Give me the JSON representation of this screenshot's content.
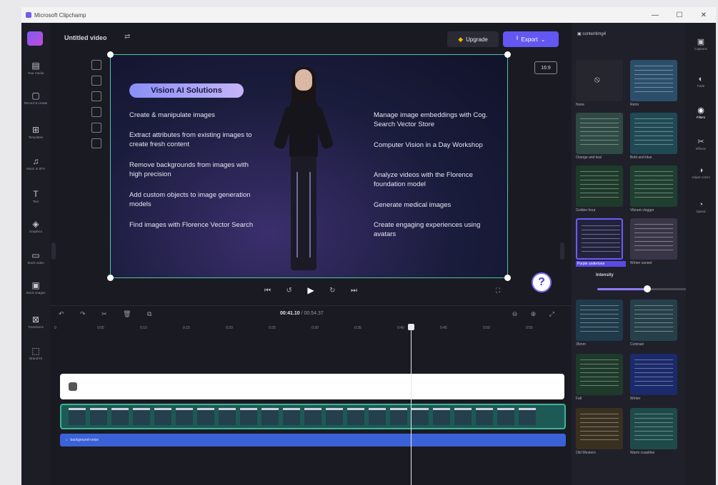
{
  "window": {
    "title": "Microsoft Clipchamp",
    "controls": [
      "—",
      "☐",
      "✕"
    ]
  },
  "left_rail": [
    {
      "name": "your-media",
      "icon": "▤",
      "label": "Your media"
    },
    {
      "name": "record-create",
      "icon": "▢",
      "label": "Record & create"
    },
    {
      "name": "templates",
      "icon": "⊞",
      "label": "Templates"
    },
    {
      "name": "music-sfx",
      "icon": "♫",
      "label": "Music & SFX"
    },
    {
      "name": "text",
      "icon": "T",
      "label": "Text"
    },
    {
      "name": "graphics",
      "icon": "◈",
      "label": "Graphics"
    },
    {
      "name": "stock-video",
      "icon": "▭",
      "label": "Stock video"
    },
    {
      "name": "stock-images",
      "icon": "▣",
      "label": "Stock images"
    },
    {
      "name": "transitions",
      "icon": "⊠",
      "label": "Transitions"
    },
    {
      "name": "brand-kit",
      "icon": "⬚",
      "label": "Brand kit"
    }
  ],
  "header": {
    "project_name": "Untitled video",
    "upgrade_label": "Upgrade",
    "export_label": "Export",
    "export_chevron": "⌄",
    "aspect_ratio": "16:9"
  },
  "slide": {
    "pill_title": "Vision AI Solutions",
    "left_bullets": [
      "Create & manipulate images",
      "Extract attributes from existing images to create fresh content",
      "Remove backgrounds from images with high precision",
      "Add custom objects to image generation models",
      "Find images with Florence Vector Search"
    ],
    "right_bullets": [
      "Manage image embeddings with Cog. Search Vector Store",
      "Computer Vision in a Day Workshop",
      "Analyze videos with the Florence foundation model",
      "Generate medical images",
      "Create engaging experiences using avatars"
    ]
  },
  "playback": {
    "skip_back": "⏮",
    "rewind": "↺",
    "play": "▶",
    "forward": "↻",
    "skip_forward": "⏭",
    "fullscreen": "⛶",
    "help": "?"
  },
  "timeline": {
    "current_time": "00:41.10",
    "total_time": "/ 00:54.37",
    "edit_icons": "↶ ↷ ✂ 🗑 ⧉",
    "zoom_icons": "⊖ ⊕ ⤢",
    "ruler": [
      "0",
      "0:05",
      "0:10",
      "0:15",
      "0:20",
      "0:25",
      "0:30",
      "0:35",
      "0:40",
      "0:45",
      "0:50",
      "0:55"
    ],
    "audio_label": "background-voice",
    "audio_icon": "♪"
  },
  "filters_panel": {
    "header": "contentimg4",
    "intensity_label": "Intensity",
    "intensity": 0.5,
    "filters": [
      {
        "name": "None"
      },
      {
        "name": "Retro"
      },
      {
        "name": "Orange and teal"
      },
      {
        "name": "Bold and blue"
      },
      {
        "name": "Golden hour"
      },
      {
        "name": "Vibrant vlogger"
      },
      {
        "name": "Purple undertone",
        "selected": true
      },
      {
        "name": "Winter sunset"
      },
      {
        "name": "35mm"
      },
      {
        "name": "Contrast"
      },
      {
        "name": "Fall"
      },
      {
        "name": "Winter"
      },
      {
        "name": "Old Western"
      },
      {
        "name": "Warm coastline"
      }
    ]
  },
  "right_rail": [
    {
      "name": "captions",
      "icon": "▣",
      "label": "Captions"
    },
    {
      "name": "fade",
      "icon": "◐",
      "label": "Fade"
    },
    {
      "name": "filters",
      "icon": "◉",
      "label": "Filters",
      "active": true
    },
    {
      "name": "effects",
      "icon": "✂",
      "label": "Effects"
    },
    {
      "name": "adjust-colors",
      "icon": "◑",
      "label": "Adjust colors"
    },
    {
      "name": "speed",
      "icon": "◔",
      "label": "Speed"
    }
  ]
}
